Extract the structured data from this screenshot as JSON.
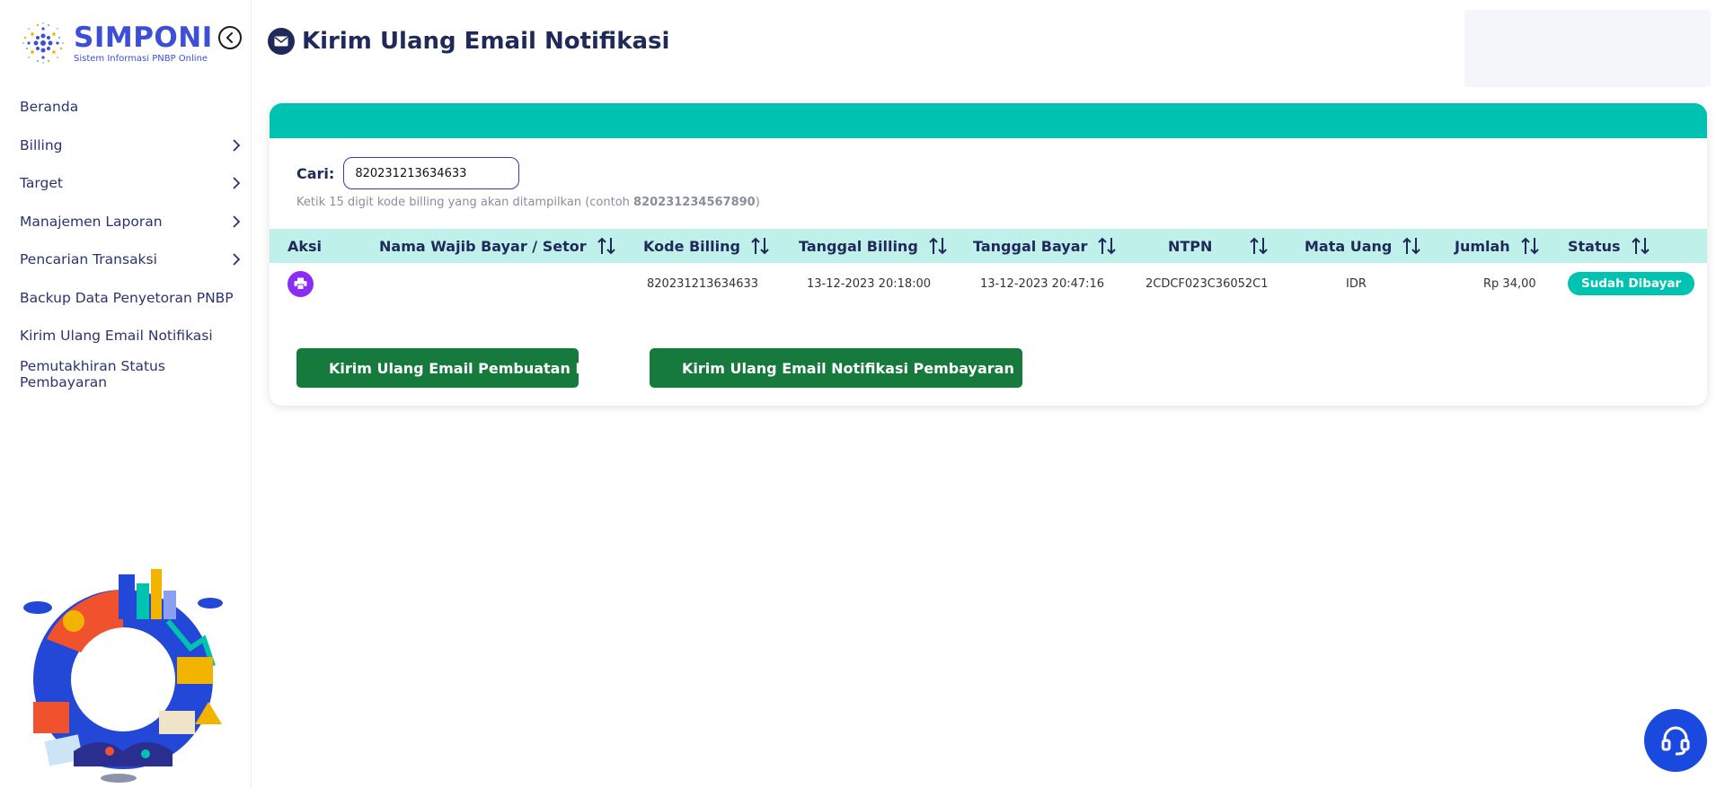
{
  "brand": {
    "name": "SIMPONI",
    "tagline": "Sistem Informasi PNBP Online",
    "color": "#3d4fd6"
  },
  "sidebar": {
    "items": [
      {
        "label": "Beranda",
        "has_submenu": false,
        "icon": "none"
      },
      {
        "label": "Billing",
        "has_submenu": true,
        "icon": "chevron-right-icon"
      },
      {
        "label": "Target",
        "has_submenu": true,
        "icon": "chevron-right-icon"
      },
      {
        "label": "Manajemen Laporan",
        "has_submenu": true,
        "icon": "chevron-right-icon"
      },
      {
        "label": "Pencarian Transaksi",
        "has_submenu": true,
        "icon": "chevron-right-icon"
      },
      {
        "label": "Backup Data Penyetoran PNBP",
        "has_submenu": false,
        "icon": "none"
      },
      {
        "label": "Kirim Ulang Email Notifikasi",
        "has_submenu": false,
        "icon": "none"
      },
      {
        "label": "Pemutakhiran Status Pembayaran",
        "has_submenu": false,
        "icon": "none"
      }
    ]
  },
  "header": {
    "title": "Kirim Ulang Email Notifikasi",
    "icon": "envelope-icon"
  },
  "search": {
    "label": "Cari:",
    "value": "820231213634633",
    "hint_prefix": "Ketik 15 digit kode billing yang akan ditampilkan (contoh ",
    "hint_example": "820231234567890",
    "hint_suffix": ")"
  },
  "table": {
    "columns": [
      "Aksi",
      "Nama Wajib Bayar / Setor",
      "Kode Billing",
      "Tanggal Billing",
      "Tanggal Bayar",
      "NTPN",
      "Mata Uang",
      "Jumlah",
      "Status"
    ],
    "rows": [
      {
        "nama": "",
        "kode_billing": "820231213634633",
        "tanggal_billing": "13-12-2023 20:18:00",
        "tanggal_bayar": "13-12-2023 20:47:16",
        "ntpn": "2CDCF023C36052C1",
        "mata_uang": "IDR",
        "jumlah": "Rp 34,00",
        "status": "Sudah Dibayar"
      }
    ]
  },
  "actions": {
    "resend_billing": "Kirim Ulang Email Pembuatan Billing",
    "resend_payment": "Kirim Ulang Email Notifikasi Pembayaran"
  },
  "colors": {
    "accent_teal": "#00c2b0",
    "header_teal_light": "#c0f0ea",
    "button_green": "#157a3c",
    "print_purple": "#8b2cf5",
    "help_blue": "#1a49e0",
    "text_navy": "#1f2a5a"
  }
}
